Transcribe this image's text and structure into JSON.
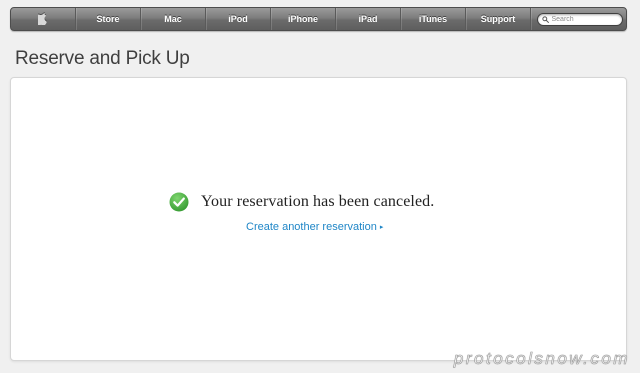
{
  "nav": {
    "items": [
      {
        "label": "Store"
      },
      {
        "label": "Mac"
      },
      {
        "label": "iPod"
      },
      {
        "label": "iPhone"
      },
      {
        "label": "iPad"
      },
      {
        "label": "iTunes"
      },
      {
        "label": "Support"
      }
    ],
    "search": {
      "placeholder": "Search",
      "value": ""
    }
  },
  "page": {
    "title": "Reserve and Pick Up"
  },
  "confirmation": {
    "message": "Your reservation has been canceled.",
    "link_label": "Create another reservation",
    "link_arrow": "▸"
  },
  "watermark": {
    "text": "protocolsnow.com"
  },
  "icons": {
    "logo": "apple-logo-icon",
    "search": "search-icon",
    "success": "checkmark-icon",
    "link_arrow": "arrow-right-icon"
  },
  "colors": {
    "nav_background": "#7d7d7d",
    "page_background": "#f0f0f0",
    "link": "#1f86c7",
    "success": "#4cb848",
    "title_text": "#3f3f3f"
  }
}
